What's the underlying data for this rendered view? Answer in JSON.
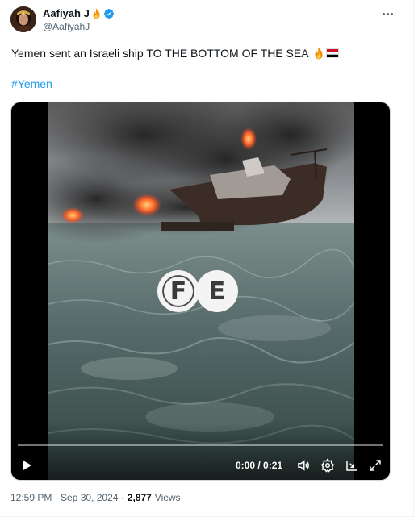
{
  "author": {
    "display_name": "Aafiyah J",
    "handle": "@AafiyahJ",
    "icons": [
      "fire-emoji",
      "verified-badge-icon"
    ]
  },
  "post": {
    "text": "Yemen sent an Israeli ship TO THE BOTTOM OF THE SEA",
    "text_emojis": [
      "fire-emoji",
      "yemen-flag"
    ],
    "hashtag": "#Yemen",
    "timestamp": "12:59 PM · Sep 30, 2024 · ",
    "views_count": "2,877",
    "views_label": "Views"
  },
  "video": {
    "watermark_letters": [
      "F",
      "E"
    ],
    "current_time": "0:00",
    "duration": "0:21",
    "time_display": "0:00 / 0:21",
    "progress": 0.0,
    "controls": [
      "play-icon",
      "volume-icon",
      "settings-icon",
      "pip-icon",
      "fullscreen-icon"
    ]
  },
  "colors": {
    "link": "#1d9bf0",
    "secondary_text": "#536471",
    "verified": "#1d9bf0"
  }
}
